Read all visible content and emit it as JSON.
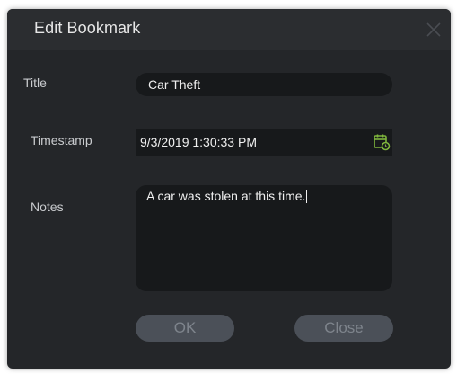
{
  "dialog": {
    "title": "Edit Bookmark",
    "close_icon": "close-x-icon"
  },
  "form": {
    "title_label": "Title",
    "title_value": "Car Theft",
    "timestamp_label": "Timestamp",
    "timestamp_value": "9/3/2019 1:30:33 PM",
    "calendar_icon": "calendar-clock-icon",
    "notes_label": "Notes",
    "notes_value": "A car was stolen at this time."
  },
  "buttons": {
    "ok_label": "OK",
    "close_label": "Close"
  },
  "colors": {
    "dialog_bg": "#242629",
    "field_bg": "#17191b",
    "button_bg": "#4b5058",
    "calendar_icon": "#7fb53d"
  }
}
